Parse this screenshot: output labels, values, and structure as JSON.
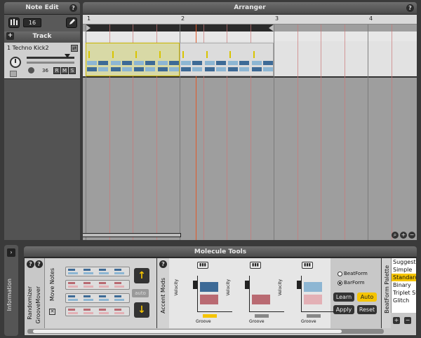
{
  "note_edit": {
    "title": "Note Edit",
    "help": "?",
    "grid_value": "16",
    "grid_icon": "grid-icon",
    "pencil_icon": "pencil-icon"
  },
  "track_panel": {
    "add_label": "+",
    "header": "Track",
    "track": {
      "name": "1 Techno Kick2",
      "volume": "36",
      "record": "R",
      "mute": "M",
      "solo": "S"
    }
  },
  "arranger": {
    "title": "Arranger",
    "help": "?",
    "bars": [
      "1",
      "2",
      "3",
      "4"
    ],
    "colors": {
      "clip_fill": "#d8d9a6",
      "clip_border": "#c9b400",
      "playhead": "#e05a2a",
      "block_blue": "#3d6a96",
      "block_light": "#8db6d3",
      "block_red": "#b96a72"
    }
  },
  "information": {
    "label": "Information"
  },
  "molecule_tools": {
    "title": "Molecule Tools",
    "help": "?",
    "sections": {
      "randomizer": "Randomizer",
      "groovemover": "GrooveMover",
      "move_notes": "Move Notes",
      "accent_mods": "Accent Mods"
    },
    "auto_label": "auto",
    "up_arrow": "↑",
    "down_arrow": "↓",
    "velocity_label": "Velocity",
    "groove_label": "Groove",
    "radio": {
      "beatform": "BeatForm",
      "barform": "BarForm"
    },
    "buttons": {
      "learn": "Learn",
      "auto": "Auto",
      "apply": "Apply",
      "reset": "Reset"
    },
    "palette": {
      "label": "BeatForm Palette",
      "items": [
        "Suggested",
        "Simple",
        "Standard",
        "Binary",
        "Triplet Swing",
        "Glitch"
      ],
      "selected": "Standard",
      "add": "+",
      "remove": "−"
    }
  }
}
